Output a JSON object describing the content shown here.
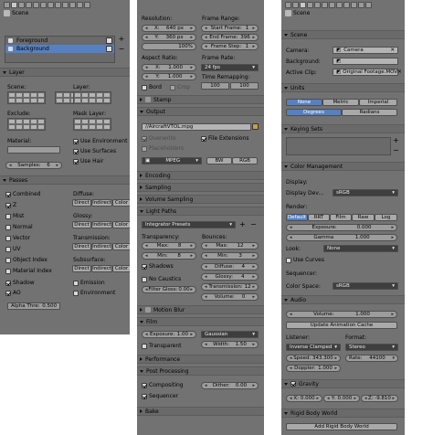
{
  "panel1": {
    "breadcrumb": "Scene",
    "render_layers": [
      "Foreground",
      "Background"
    ],
    "layer_header": "Layer",
    "scene_label": "Scene:",
    "layer_label": "Layer:",
    "exclude_label": "Exclude:",
    "mask_layer_label": "Mask Layer:",
    "material_label": "Material:",
    "use_environment": "Use Environment",
    "use_surfaces": "Use Surfaces",
    "use_hair": "Use Hair",
    "samples_label": "Samples:",
    "samples_value": "6",
    "passes_header": "Passes",
    "passes_left": [
      "Combined",
      "Z",
      "Mist",
      "Normal",
      "Vector",
      "UV",
      "Object Index",
      "Material Index"
    ],
    "passes_left_checked": [
      true,
      true,
      false,
      false,
      false,
      false,
      false,
      false
    ],
    "diffuse_label": "Diffuse:",
    "glossy_label": "Glossy:",
    "transmission_label": "Transmission:",
    "subsurface_label": "Subsurface:",
    "pass_buttons": [
      "Direct",
      "Indirect",
      "Color"
    ],
    "shadow": "Shadow",
    "emission": "Emission",
    "ao": "AO",
    "environment": "Environment",
    "alpha_thresh_label": "Alpha Thre:",
    "alpha_thresh_value": "0.500"
  },
  "panel2": {
    "resolution_label": "Resolution:",
    "res_x_label": "X:",
    "res_x_value": "640 px",
    "res_y_label": "Y:",
    "res_y_value": "360 px",
    "res_pct": "100%",
    "frame_range_label": "Frame Range:",
    "start_frame_label": "Start Frame:",
    "start_frame_value": "1",
    "end_frame_label": "End Frame:",
    "end_frame_value": "396",
    "frame_step_label": "Frame Step:",
    "frame_step_value": "1",
    "aspect_ratio_label": "Aspect Ratio:",
    "aspect_x_label": "X:",
    "aspect_x_value": "1.000",
    "aspect_y_label": "Y:",
    "aspect_y_value": "1.000",
    "frame_rate_label": "Frame Rate:",
    "frame_rate_value": "24 fps",
    "time_remapping_label": "Time Remapping:",
    "time_old": "100",
    "time_new": "100",
    "bord": "Bord",
    "crop": "Crop",
    "stamp_header": "Stamp",
    "output_header": "Output",
    "output_path": "//AircraftVTOL.mpg",
    "overwrite": "Overwrite",
    "file_extensions": "File Extensions",
    "placeholders": "Placeholders",
    "format_value": "MPEG",
    "bw": "BW",
    "rgb": "RGB",
    "encoding_header": "Encoding",
    "sampling_header": "Sampling",
    "volume_sampling_header": "Volume Sampling",
    "light_paths_header": "Light Paths",
    "integrator_presets": "Integrator Presets",
    "transparency_label": "Transparency:",
    "bounces_label": "Bounces:",
    "t_max_label": "Max:",
    "t_max_value": "8",
    "t_min_label": "Min:",
    "t_min_value": "8",
    "b_max_label": "Max:",
    "b_max_value": "12",
    "b_min_label": "Min:",
    "b_min_value": "3",
    "shadows": "Shadows",
    "no_caustics": "No Caustics",
    "filter_glossy_label": "Filter Gloss:",
    "filter_glossy_value": "0.00",
    "diffuse_label": "Diffuse:",
    "diffuse_value": "4",
    "glossy_label": "Glossy:",
    "glossy_value": "4",
    "transmission_label": "Transmission:",
    "transmission_value": "12",
    "volume_label": "Volume:",
    "volume_value": "0",
    "motion_blur_header": "Motion Blur",
    "film_header": "Film",
    "exposure_label": "Exposure:",
    "exposure_value": "1.00",
    "filter_type": "Gaussian",
    "transparent": "Transparent",
    "width_label": "Width:",
    "width_value": "1.50",
    "performance_header": "Performance",
    "post_processing_header": "Post Processing",
    "compositing": "Compositing",
    "sequencer": "Sequencer",
    "dither_label": "Dither:",
    "dither_value": "0.00",
    "bake_header": "Bake"
  },
  "panel3": {
    "breadcrumb": "Scene",
    "scene_header": "Scene",
    "camera_label": "Camera:",
    "camera_value": "Camera",
    "background_label": "Background:",
    "active_clip_label": "Active Clip:",
    "active_clip_value": "Original Footage.MOV",
    "units_header": "Units",
    "unit_systems": [
      "None",
      "Metric",
      "Imperial"
    ],
    "unit_angles": [
      "Degrees",
      "Radians"
    ],
    "keying_sets_header": "Keying Sets",
    "color_management_header": "Color Management",
    "display_label": "Display:",
    "display_device_label": "Display Dev...",
    "display_device_value": "sRGB",
    "render_label": "Render:",
    "view_tabs": [
      "Default",
      "RRT",
      "Film",
      "Raw",
      "Log"
    ],
    "exposure_label": "Exposure:",
    "exposure_value": "0.000",
    "gamma_label": "Gamma",
    "gamma_value": "1.000",
    "look_label": "Look:",
    "look_value": "None",
    "use_curves": "Use Curves",
    "sequencer_label": "Sequencer:",
    "color_space_label": "Color Space:",
    "color_space_value": "sRGB",
    "audio_header": "Audio",
    "volume_label": "Volume:",
    "volume_value": "1.000",
    "update_cache": "Update Animation Cache",
    "listener_label": "Listener:",
    "listener_value": "Inverse Clamped",
    "format_label": "Format:",
    "format_value": "Stereo",
    "speed_label": "Speed:",
    "speed_value": "343.300",
    "rate_label": "Rate:",
    "rate_value": "44100",
    "doppler_label": "Doppler:",
    "doppler_value": "1.000",
    "gravity_header": "Gravity",
    "gx_label": "X:",
    "gx_value": "0.000",
    "gy_label": "Y:",
    "gy_value": "0.000",
    "gz_label": "Z:",
    "gz_value": "-9.810",
    "rigid_body_header": "Rigid Body World",
    "add_rigid_body": "Add Rigid Body World"
  },
  "colors": {
    "panel_bg": "#727272",
    "header_bg": "#6a6a6a",
    "field_bg": "#9c9c9c",
    "selected": "#5680c2"
  }
}
